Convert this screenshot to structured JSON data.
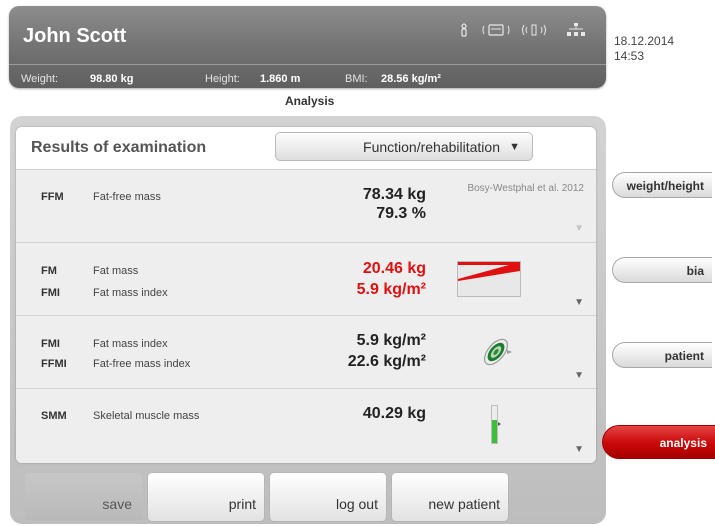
{
  "header": {
    "patient_name": "John Scott",
    "weight_label": "Weight:",
    "weight_value": "98.80 kg",
    "height_label": "Height:",
    "height_value": "1.860 m",
    "bmi_label": "BMI:",
    "bmi_value": "28.56 kg/m²",
    "date": "18.12.2014",
    "time": "14:53",
    "status_icons": [
      "person-icon",
      "printer-icon",
      "wireless-icon",
      "network-icon"
    ]
  },
  "page_heading": "Analysis",
  "results": {
    "title": "Results of examination",
    "dropdown_value": "Function/rehabilitation",
    "rows": [
      {
        "lines": [
          {
            "abbr": "FFM",
            "label": "Fat-free mass"
          }
        ],
        "values": [
          "78.34 kg",
          "79.3 %"
        ],
        "reference": "Bosy-Westphal et al. 2012",
        "highlight": false,
        "graphic": "none"
      },
      {
        "lines": [
          {
            "abbr": "FM",
            "label": "Fat mass"
          },
          {
            "abbr": "FMI",
            "label": "Fat mass index"
          }
        ],
        "values": [
          "20.46 kg",
          "5.9 kg/m²"
        ],
        "highlight": true,
        "graphic": "fat-mass-scale-icon"
      },
      {
        "lines": [
          {
            "abbr": "FMI",
            "label": "Fat mass index"
          },
          {
            "abbr": "FFMI",
            "label": "Fat-free mass index"
          }
        ],
        "values": [
          "5.9 kg/m²",
          "22.6 kg/m²"
        ],
        "highlight": false,
        "graphic": "target-ellipse-icon"
      },
      {
        "lines": [
          {
            "abbr": "SMM",
            "label": "Skeletal muscle mass"
          }
        ],
        "values": [
          "40.29 kg"
        ],
        "highlight": false,
        "graphic": "vertical-gauge-icon"
      }
    ]
  },
  "side_tabs": [
    {
      "label": "weight/height",
      "active": false
    },
    {
      "label": "bia",
      "active": false
    },
    {
      "label": "patient",
      "active": false
    },
    {
      "label": "analysis",
      "active": true
    }
  ],
  "buttons": {
    "save": "save",
    "print": "print",
    "logout": "log out",
    "new_patient": "new patient"
  },
  "colors": {
    "highlight_value": "#e01010",
    "active_tab": "#c90808",
    "header_bg": "#747474"
  }
}
